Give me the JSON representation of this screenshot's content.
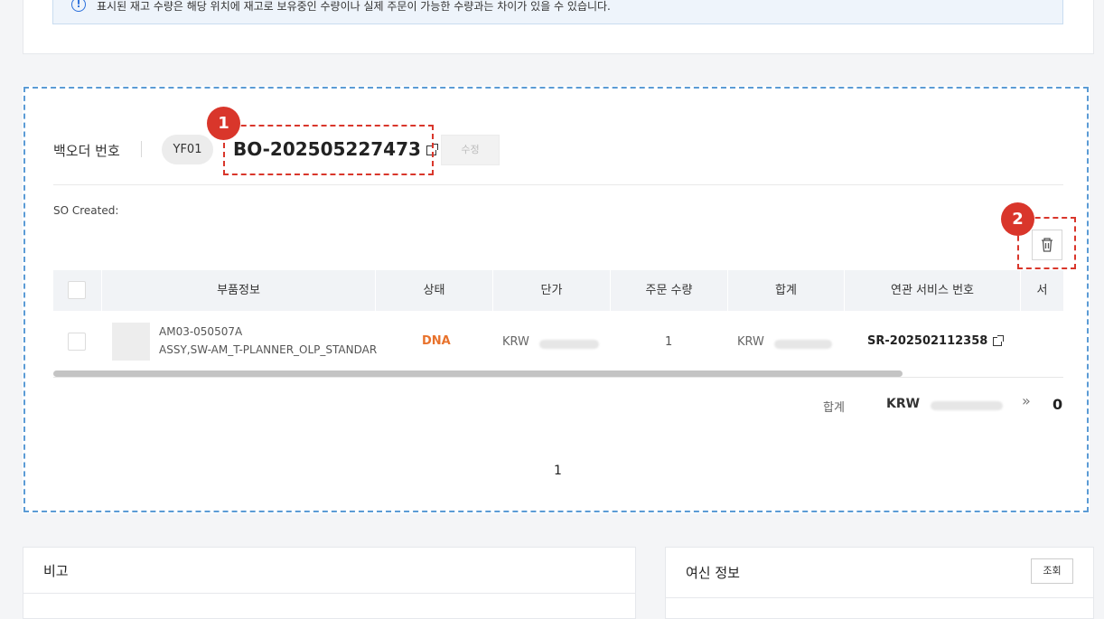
{
  "notice": {
    "icon": "info-icon",
    "text": "표시된 재고 수량은 해당 위치에 재고로 보유중인 수량이나 실제 주문이 가능한 수량과는 차이가 있을 수 있습니다."
  },
  "backorder": {
    "label": "백오더 번호",
    "plant": "YF01",
    "number": "BO-202505227473",
    "edit_label": "수정",
    "so_created": "SO Created:"
  },
  "markers": [
    "1",
    "2"
  ],
  "table": {
    "columns": [
      "부품정보",
      "상태",
      "단가",
      "주문 수량",
      "합계",
      "연관 서비스 번호",
      "서"
    ],
    "rows": [
      {
        "part_code": "AM03-050507A",
        "part_name": "ASSY,SW-AM_T-PLANNER_OLP_STANDARD",
        "status": "DNA",
        "unit_currency": "KRW",
        "qty": "1",
        "total_currency": "KRW",
        "service_no": "SR-202502112358"
      }
    ]
  },
  "totals": {
    "label": "합계",
    "currency": "KRW",
    "more": "»",
    "count": "0"
  },
  "pagination": {
    "current": "1"
  },
  "remarks": {
    "title": "비고"
  },
  "credit": {
    "title": "여신 정보",
    "query_label": "조회"
  },
  "colors": {
    "status_dna": "#e8722c",
    "marker": "#d9362b",
    "outline": "#5b9bd5"
  }
}
